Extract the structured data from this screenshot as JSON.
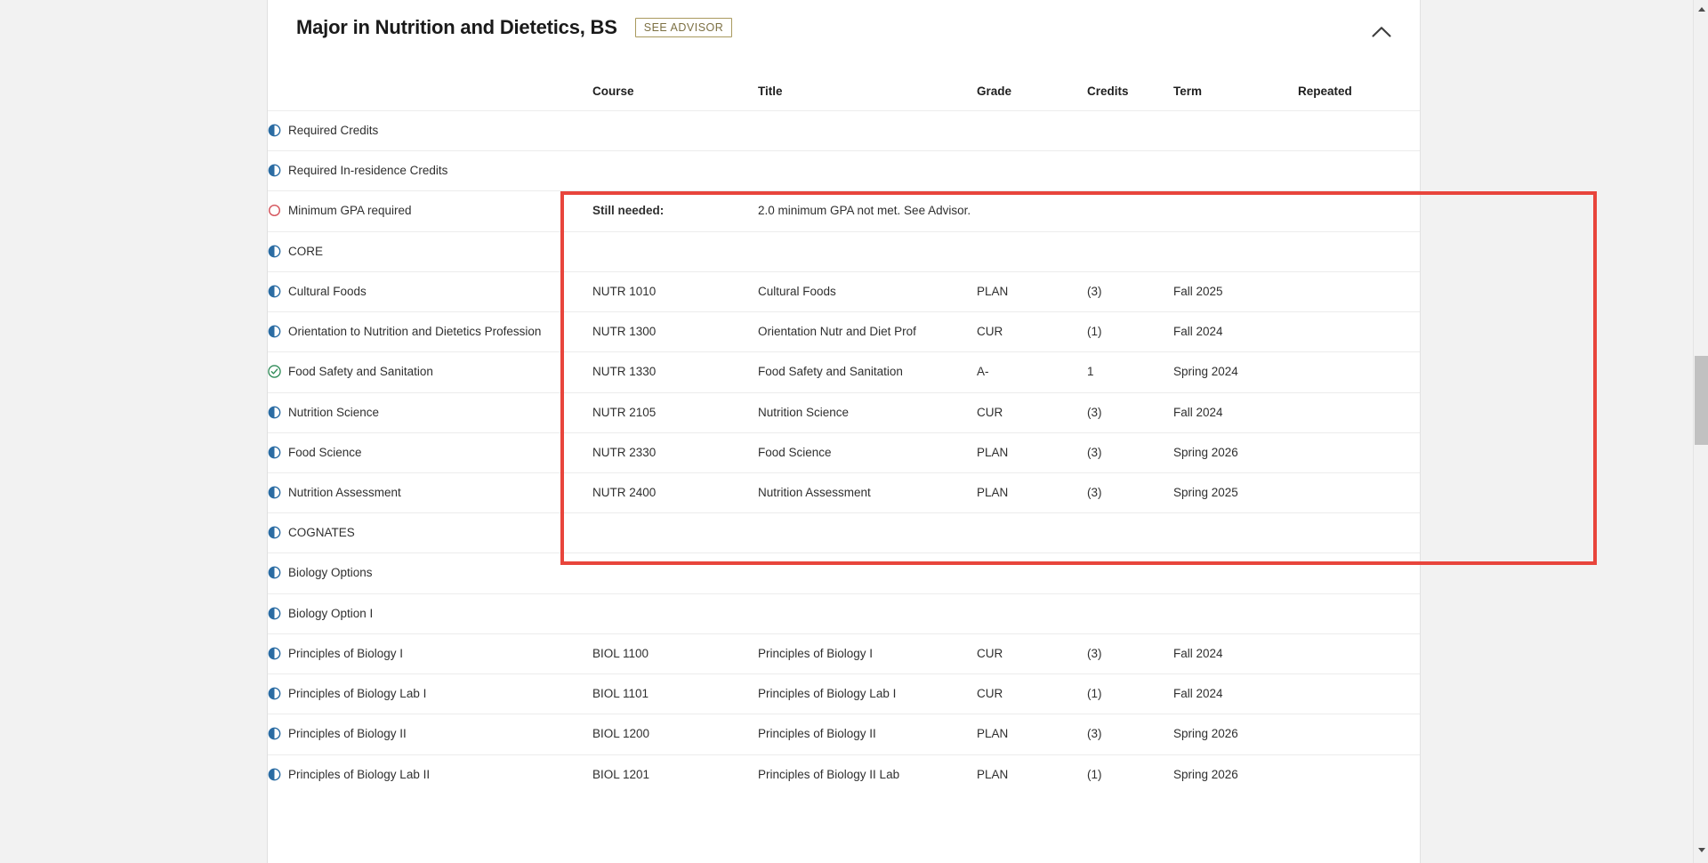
{
  "header": {
    "title": "Major in Nutrition and Dietetics, BS",
    "advisor_badge": "SEE ADVISOR",
    "collapse_icon": "chevron-up-icon"
  },
  "columns": {
    "name": "",
    "course": "Course",
    "title": "Title",
    "grade": "Grade",
    "credits": "Credits",
    "term": "Term",
    "repeated": "Repeated"
  },
  "colors": {
    "highlight_border": "#e8453c",
    "in_progress_icon": "#2b6ca3",
    "complete_icon": "#2e8b57",
    "not_met_icon": "#d4525a",
    "badge_border": "#a99a5e",
    "badge_text": "#7c7043"
  },
  "rows": [
    {
      "indent": 0,
      "icon": "half-filled-circle-icon",
      "status": "in-progress",
      "label": "Required Credits",
      "course": "",
      "title": "",
      "grade": "",
      "credits": "",
      "term": "",
      "repeated": ""
    },
    {
      "indent": 0,
      "icon": "half-filled-circle-icon",
      "status": "in-progress",
      "label": "Required In-residence Credits",
      "course": "",
      "title": "",
      "grade": "",
      "credits": "",
      "term": "",
      "repeated": ""
    },
    {
      "indent": 0,
      "icon": "open-circle-icon",
      "status": "not-met",
      "label": "Minimum GPA required",
      "course": "Still needed:",
      "course_bold": true,
      "title": "2.0 minimum GPA not met. See Advisor.",
      "grade": "",
      "credits": "",
      "term": "",
      "repeated": ""
    },
    {
      "indent": 0,
      "icon": "half-filled-circle-icon",
      "status": "in-progress",
      "label": "CORE",
      "course": "",
      "title": "",
      "grade": "",
      "credits": "",
      "term": "",
      "repeated": ""
    },
    {
      "indent": 1,
      "icon": "half-filled-circle-icon",
      "status": "in-progress",
      "label": "Cultural Foods",
      "course": "NUTR 1010",
      "title": "Cultural Foods",
      "grade": "PLAN",
      "credits": "(3)",
      "term": "Fall 2025",
      "repeated": ""
    },
    {
      "indent": 1,
      "icon": "half-filled-circle-icon",
      "status": "in-progress",
      "label": "Orientation to Nutrition and Dietetics Profession",
      "course": "NUTR 1300",
      "title": "Orientation Nutr and Diet Prof",
      "grade": "CUR",
      "credits": "(1)",
      "term": "Fall 2024",
      "repeated": ""
    },
    {
      "indent": 1,
      "icon": "check-circle-icon",
      "status": "complete",
      "label": "Food Safety and Sanitation",
      "course": "NUTR 1330",
      "title": "Food Safety and Sanitation",
      "grade": "A-",
      "credits": "1",
      "term": "Spring 2024",
      "repeated": ""
    },
    {
      "indent": 1,
      "icon": "half-filled-circle-icon",
      "status": "in-progress",
      "label": "Nutrition Science",
      "course": "NUTR 2105",
      "title": "Nutrition Science",
      "grade": "CUR",
      "credits": "(3)",
      "term": "Fall 2024",
      "repeated": ""
    },
    {
      "indent": 1,
      "icon": "half-filled-circle-icon",
      "status": "in-progress",
      "label": "Food Science",
      "course": "NUTR 2330",
      "title": "Food Science",
      "grade": "PLAN",
      "credits": "(3)",
      "term": "Spring 2026",
      "repeated": ""
    },
    {
      "indent": 1,
      "icon": "half-filled-circle-icon",
      "status": "in-progress",
      "label": "Nutrition Assessment",
      "course": "NUTR 2400",
      "title": "Nutrition Assessment",
      "grade": "PLAN",
      "credits": "(3)",
      "term": "Spring 2025",
      "repeated": ""
    },
    {
      "indent": 0,
      "icon": "half-filled-circle-icon",
      "status": "in-progress",
      "label": "COGNATES",
      "course": "",
      "title": "",
      "grade": "",
      "credits": "",
      "term": "",
      "repeated": ""
    },
    {
      "indent": 1,
      "icon": "half-filled-circle-icon",
      "status": "in-progress",
      "label": "Biology Options",
      "course": "",
      "title": "",
      "grade": "",
      "credits": "",
      "term": "",
      "repeated": ""
    },
    {
      "indent": 2,
      "icon": "half-filled-circle-icon",
      "status": "in-progress",
      "label": "Biology Option I",
      "course": "",
      "title": "",
      "grade": "",
      "credits": "",
      "term": "",
      "repeated": ""
    },
    {
      "indent": 3,
      "icon": "half-filled-circle-icon",
      "status": "in-progress",
      "label": "Principles of Biology I",
      "course": "BIOL 1100",
      "title": "Principles of Biology I",
      "grade": "CUR",
      "credits": "(3)",
      "term": "Fall 2024",
      "repeated": ""
    },
    {
      "indent": 3,
      "icon": "half-filled-circle-icon",
      "status": "in-progress",
      "label": "Principles of Biology Lab I",
      "course": "BIOL 1101",
      "title": "Principles of Biology Lab I",
      "grade": "CUR",
      "credits": "(1)",
      "term": "Fall 2024",
      "repeated": ""
    },
    {
      "indent": 3,
      "icon": "half-filled-circle-icon",
      "status": "in-progress",
      "label": "Principles of Biology II",
      "course": "BIOL 1200",
      "title": "Principles of Biology II",
      "grade": "PLAN",
      "credits": "(3)",
      "term": "Spring 2026",
      "repeated": ""
    },
    {
      "indent": 3,
      "icon": "half-filled-circle-icon",
      "status": "in-progress",
      "label": "Principles of Biology Lab II",
      "course": "BIOL 1201",
      "title": "Principles of Biology II Lab",
      "grade": "PLAN",
      "credits": "(1)",
      "term": "Spring 2026",
      "repeated": ""
    }
  ],
  "scrollbar": {
    "up_icon": "scroll-up-arrow-icon",
    "down_icon": "scroll-down-arrow-icon"
  }
}
